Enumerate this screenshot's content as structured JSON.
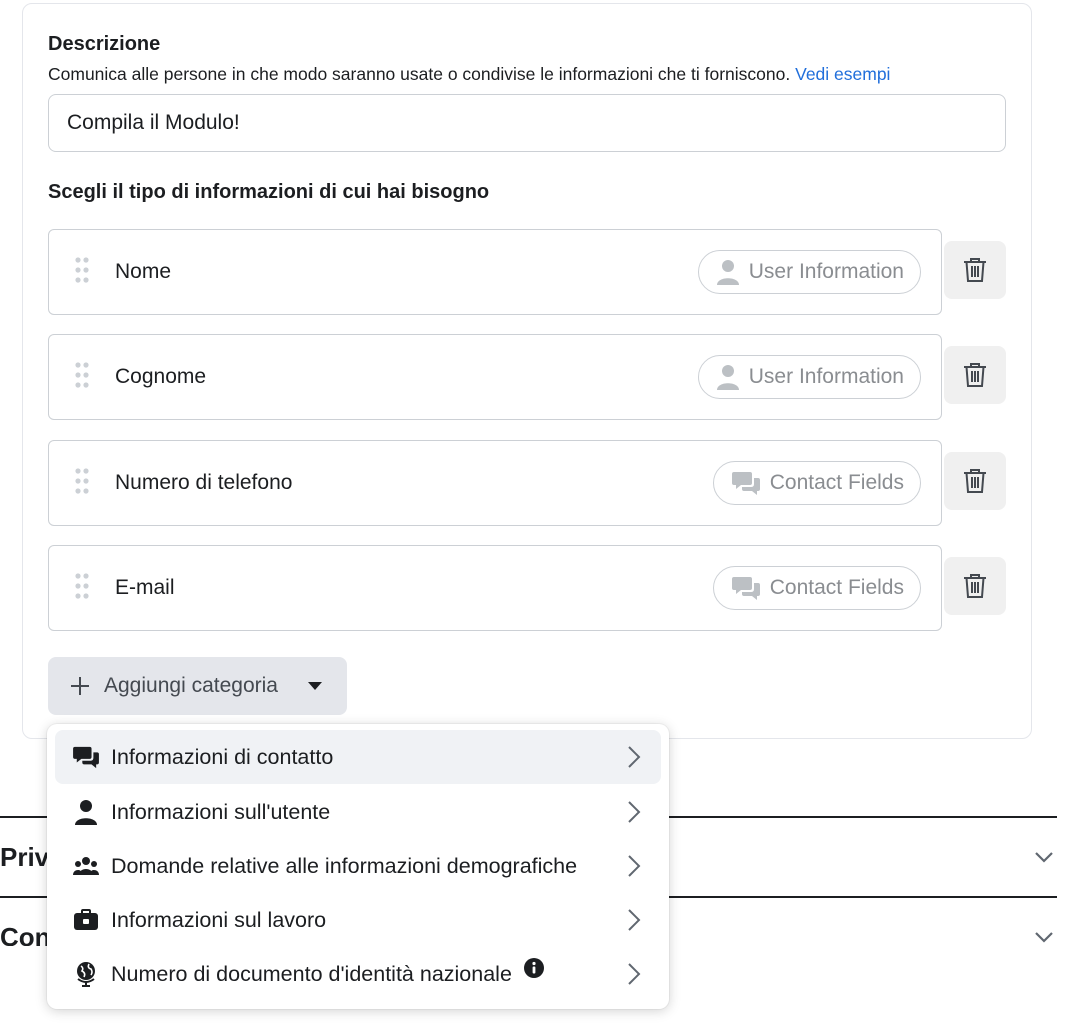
{
  "description": {
    "title": "Descrizione",
    "subtitle": "Comunica alle persone in che modo saranno usate o condivise le informazioni che ti forniscono.",
    "link": "Vedi esempi",
    "value": "Compila il Modulo!"
  },
  "questions": {
    "title": "Scegli il tipo di informazioni di cui hai bisogno",
    "fields": [
      {
        "label": "Nome",
        "category": "User Information",
        "icon": "user-icon"
      },
      {
        "label": "Cognome",
        "category": "User Information",
        "icon": "user-icon"
      },
      {
        "label": "Numero di telefono",
        "category": "Contact Fields",
        "icon": "chat-bubbles-icon"
      },
      {
        "label": "E-mail",
        "category": "Contact Fields",
        "icon": "chat-bubbles-icon"
      }
    ],
    "add_label": "Aggiungi categoria"
  },
  "accordions": [
    {
      "title": "Priv"
    },
    {
      "title": "Con"
    }
  ],
  "menu": {
    "items": [
      {
        "label": "Informazioni di contatto",
        "icon": "chat-bubbles-icon",
        "active": true
      },
      {
        "label": "Informazioni sull'utente",
        "icon": "user-icon"
      },
      {
        "label": "Domande relative alle informazioni demografiche",
        "icon": "people-group-icon"
      },
      {
        "label": "Informazioni sul lavoro",
        "icon": "briefcase-icon"
      },
      {
        "label": "Numero di documento d'identità nazionale",
        "icon": "globe-icon",
        "info": true
      }
    ]
  },
  "colors": {
    "link": "#216fdb",
    "text": "#1c1e21",
    "muted": "#8a8d91"
  }
}
